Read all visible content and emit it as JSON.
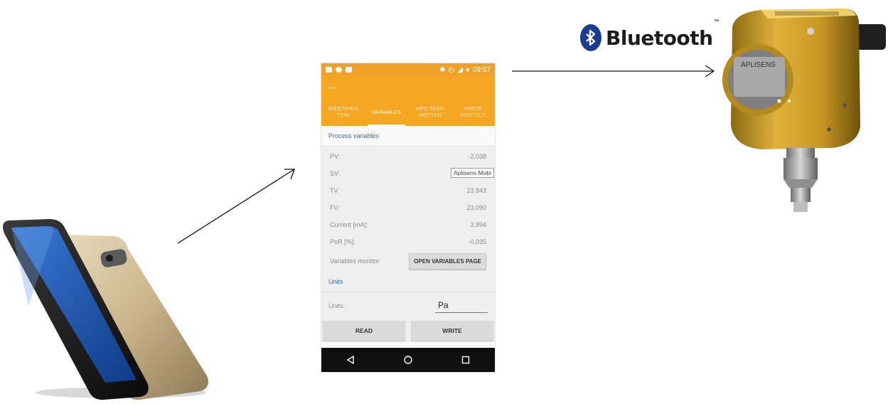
{
  "bluetooth": {
    "label": "Bluetooth",
    "trademark": "™",
    "color": "#1a3c8f"
  },
  "app": {
    "accent": "#f5a623",
    "link_color": "#2f6fb5",
    "status_bar": {
      "time": "09:57"
    },
    "tabs": [
      {
        "label": "IDENTIFICA TION"
      },
      {
        "label": "VARIABLES"
      },
      {
        "label": "MPC TRAN SMITTER"
      },
      {
        "label": "WRITE PROTECT"
      }
    ],
    "active_tab": "VARIABLES",
    "process_variables": {
      "title": "Process variables",
      "rows": [
        {
          "label": "PV:",
          "value": "-2,038"
        },
        {
          "label": "SV:",
          "value": ""
        },
        {
          "label": "TV",
          "value": "23,843"
        },
        {
          "label": "FV:",
          "value": "23,090"
        },
        {
          "label": "Current [mA]:",
          "value": "3,994"
        },
        {
          "label": "PoR [%]:",
          "value": "-0,035"
        }
      ],
      "tooltip": "Aplisens Mobi",
      "monitor_label": "Variables monitor",
      "monitor_button": "OPEN VARIABLES PAGE"
    },
    "units": {
      "title": "Units",
      "label": "Units:",
      "value": "Pa"
    },
    "buttons": {
      "read": "READ",
      "write": "WRITE"
    }
  },
  "device": {
    "brand": "APLISENS"
  }
}
